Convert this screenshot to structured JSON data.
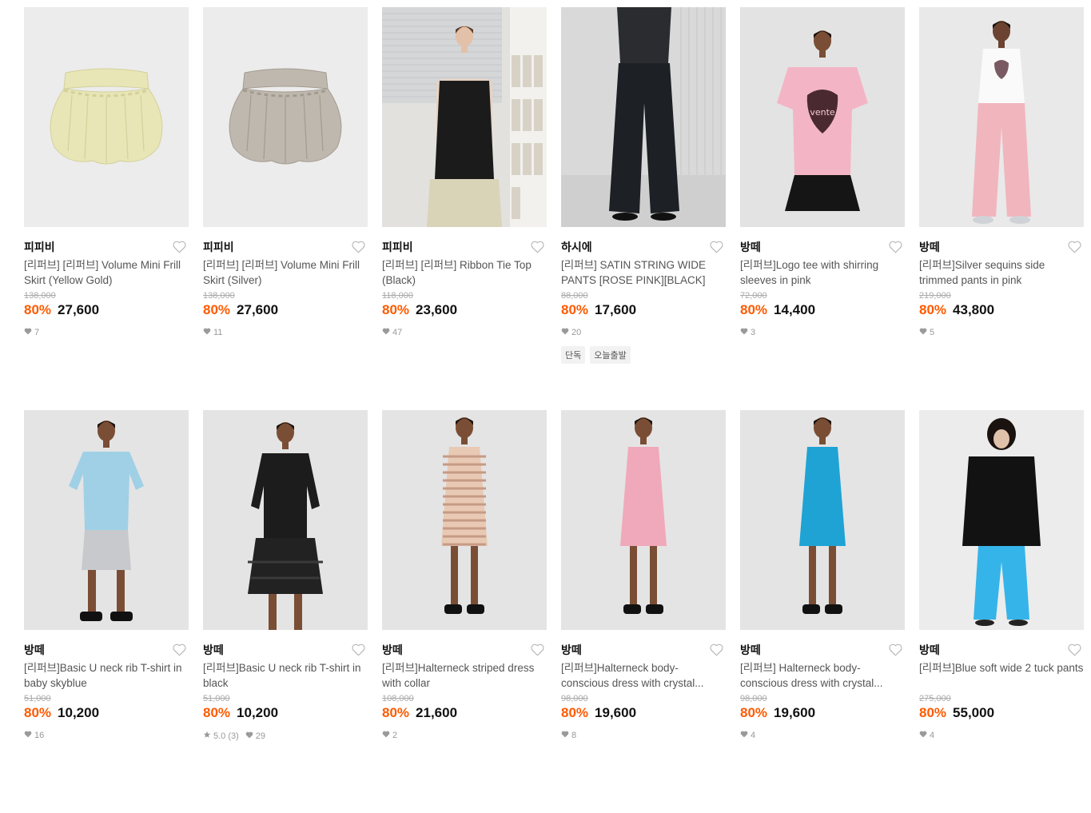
{
  "colors": {
    "discount": "#ff5a00",
    "brand_text": "#111111",
    "muted": "#999999"
  },
  "icons": {
    "wishlist": "heart-outline-icon",
    "likes": "heart-filled-icon",
    "rating": "star-icon"
  },
  "products": [
    {
      "brand": "피피비",
      "name": "[리퍼브] [리퍼브] Volume Mini Frill Skirt (Yellow Gold)",
      "original_price": "138,000",
      "discount": "80%",
      "price": "27,600",
      "likes": "7",
      "rating": "",
      "tags": [],
      "image": "yellow-gold-frill-skirt",
      "bg": "#ececec"
    },
    {
      "brand": "피피비",
      "name": "[리퍼브] [리퍼브] Volume Mini Frill Skirt (Silver)",
      "original_price": "138,000",
      "discount": "80%",
      "price": "27,600",
      "likes": "11",
      "rating": "",
      "tags": [],
      "image": "silver-frill-skirt",
      "bg": "#ececec"
    },
    {
      "brand": "피피비",
      "name": "[리퍼브] [리퍼브] Ribbon Tie Top (Black)",
      "original_price": "118,000",
      "discount": "80%",
      "price": "23,600",
      "likes": "47",
      "rating": "",
      "tags": [],
      "image": "model-black-ribbon-top",
      "bg": "#e2e1de"
    },
    {
      "brand": "하시에",
      "name": "[리퍼브] SATIN STRING WIDE PANTS [ROSE PINK][BLACK]",
      "original_price": "88,000",
      "discount": "80%",
      "price": "17,600",
      "likes": "20",
      "rating": "",
      "tags": [
        "단독",
        "오늘출발"
      ],
      "image": "model-black-satin-pants",
      "bg": "#dcdcdc"
    },
    {
      "brand": "방떼",
      "name": "[리퍼브]Logo tee with shirring sleeves in pink",
      "original_price": "72,000",
      "discount": "80%",
      "price": "14,400",
      "likes": "3",
      "rating": "",
      "tags": [],
      "image": "model-pink-logo-tee",
      "bg": "#e3e3e3"
    },
    {
      "brand": "방떼",
      "name": "[리퍼브]Silver sequins side trimmed pants in pink",
      "original_price": "219,000",
      "discount": "80%",
      "price": "43,800",
      "likes": "5",
      "rating": "",
      "tags": [],
      "image": "model-pink-sequin-pants",
      "bg": "#e9e9e9"
    },
    {
      "brand": "방떼",
      "name": "[리퍼브]Basic U neck rib T-shirt in baby skyblue",
      "original_price": "51,000",
      "discount": "80%",
      "price": "10,200",
      "likes": "16",
      "rating": "",
      "tags": [],
      "image": "model-skyblue-tshirt",
      "bg": "#e4e4e4"
    },
    {
      "brand": "방떼",
      "name": "[리퍼브]Basic U neck rib T-shirt in black",
      "original_price": "51,000",
      "discount": "80%",
      "price": "10,200",
      "likes": "29",
      "rating": "5.0 (3)",
      "tags": [],
      "image": "model-black-tshirt",
      "bg": "#e4e4e4"
    },
    {
      "brand": "방떼",
      "name": "[리퍼브]Halterneck striped dress with collar",
      "original_price": "108,000",
      "discount": "80%",
      "price": "21,600",
      "likes": "2",
      "rating": "",
      "tags": [],
      "image": "model-striped-dress",
      "bg": "#e4e4e4"
    },
    {
      "brand": "방떼",
      "name": "[리퍼브]Halterneck body-conscious dress with crystal...",
      "original_price": "98,000",
      "discount": "80%",
      "price": "19,600",
      "likes": "8",
      "rating": "",
      "tags": [],
      "image": "model-pink-dress",
      "bg": "#e4e4e4"
    },
    {
      "brand": "방떼",
      "name": "[리퍼브] Halterneck body-conscious dress with crystal...",
      "original_price": "98,000",
      "discount": "80%",
      "price": "19,600",
      "likes": "4",
      "rating": "",
      "tags": [],
      "image": "model-blue-dress",
      "bg": "#e4e4e4"
    },
    {
      "brand": "방떼",
      "name": "[리퍼브]Blue soft wide 2 tuck pants",
      "original_price": "275,000",
      "discount": "80%",
      "price": "55,000",
      "likes": "4",
      "rating": "",
      "tags": [],
      "image": "model-blue-wide-pants",
      "bg": "#ececec"
    }
  ]
}
